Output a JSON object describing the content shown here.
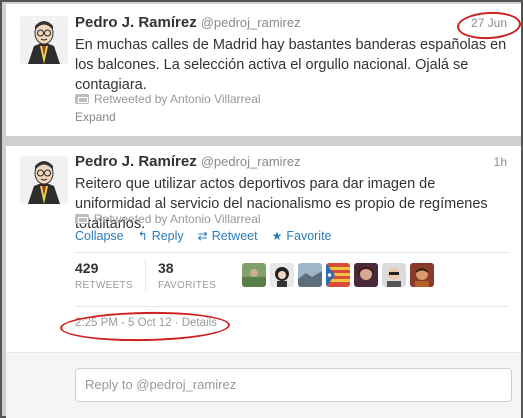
{
  "tweet1": {
    "name": "Pedro J. Ramírez",
    "handle": "@pedroj_ramirez",
    "time": "27 Jun",
    "text": "En muchas calles de Madrid hay bastantes banderas españolas en los balcones. La selección activa el orgullo nacional. Ojalá se contagiara.",
    "retweeted_by": "Retweeted by Antonio Villarreal",
    "expand_label": "Expand"
  },
  "tweet2": {
    "name": "Pedro J. Ramírez",
    "handle": "@pedroj_ramirez",
    "time": "1h",
    "text": "Reitero que utilizar actos deportivos para dar imagen de uniformidad al servicio del nacionalismo es propio de regímenes totalitarios.",
    "retweeted_by": "Retweeted by Antonio Villarreal",
    "actions": {
      "collapse": "Collapse",
      "reply": "Reply",
      "retweet": "Retweet",
      "favorite": "Favorite"
    },
    "stats": {
      "retweets_count": "429",
      "retweets_label": "RETWEETS",
      "favorites_count": "38",
      "favorites_label": "FAVORITES"
    },
    "timestamp": "2:25 PM - 5 Oct 12 · Details"
  },
  "reply": {
    "placeholder": "Reply to @pedroj_ramirez"
  },
  "colors": {
    "link": "#2b7bb9",
    "highlight_oval": "#cf1f1f"
  },
  "icons": {
    "retweet": "retweet-icon",
    "reply": "reply-arrow-icon",
    "favorite": "star-icon"
  }
}
